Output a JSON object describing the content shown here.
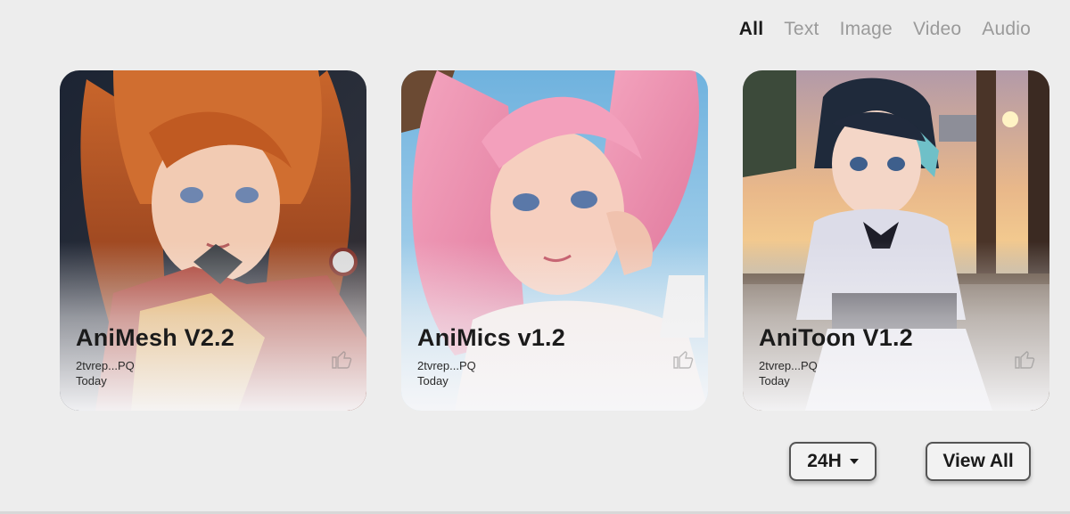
{
  "tabs": [
    {
      "label": "All",
      "active": true
    },
    {
      "label": "Text",
      "active": false
    },
    {
      "label": "Image",
      "active": false
    },
    {
      "label": "Video",
      "active": false
    },
    {
      "label": "Audio",
      "active": false
    }
  ],
  "cards": [
    {
      "title": "AniMesh V2.2",
      "author": "2tvrep...PQ",
      "date": "Today",
      "image": "anime-girl-orange-hair-armor"
    },
    {
      "title": "AniMics v1.2",
      "author": "2tvrep...PQ",
      "date": "Today",
      "image": "anime-girl-pink-hair"
    },
    {
      "title": "AniToon V1.2",
      "author": "2tvrep...PQ",
      "date": "Today",
      "image": "anime-girl-blue-hair-lakeside"
    }
  ],
  "controls": {
    "time_range": "24H",
    "view_all": "View All"
  }
}
